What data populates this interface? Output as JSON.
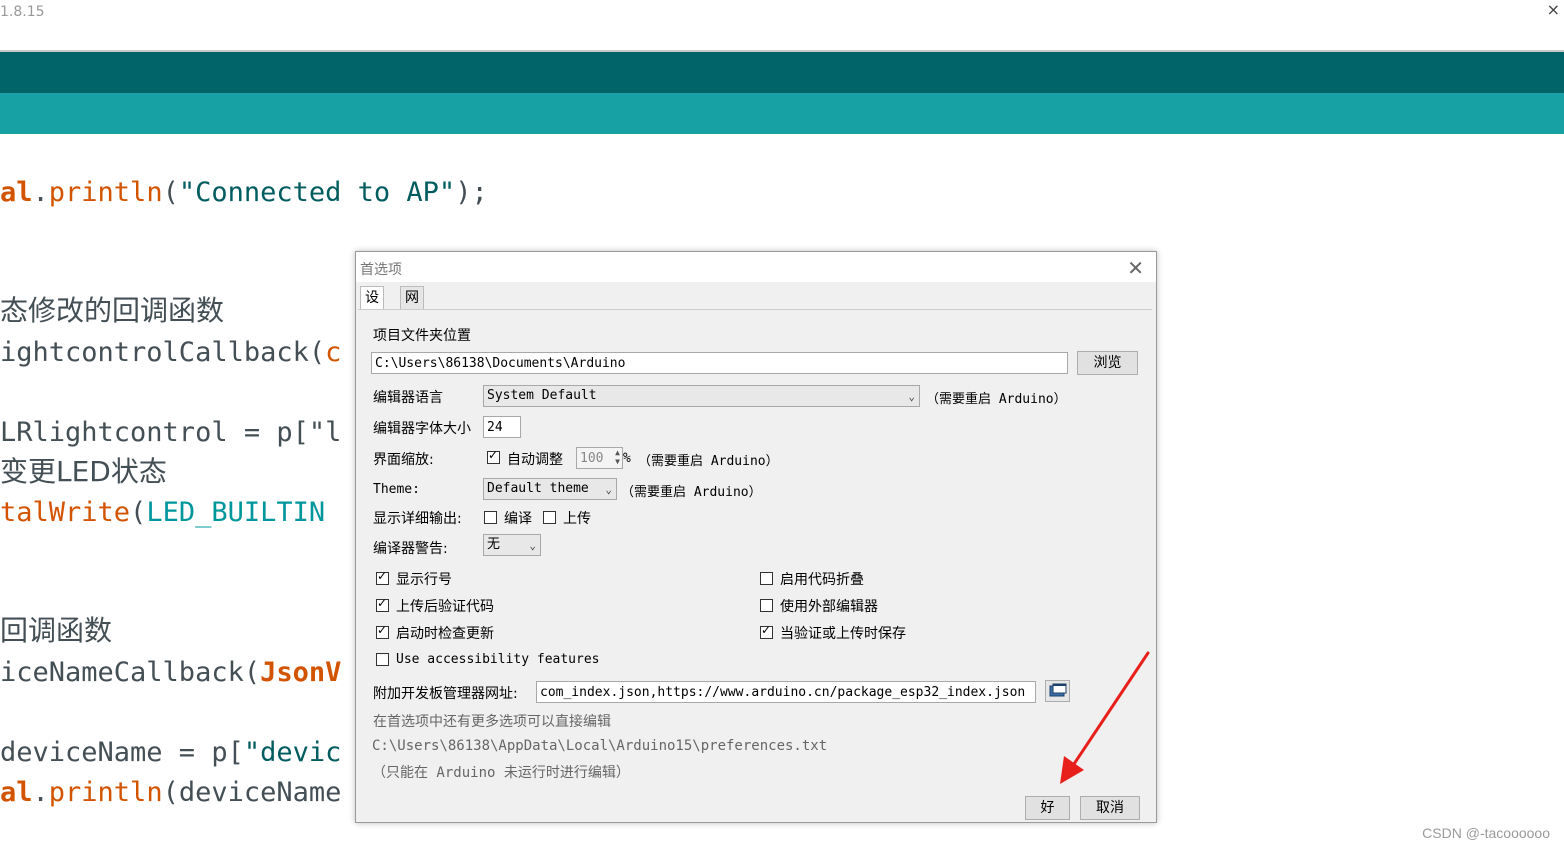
{
  "window": {
    "version": "1.8.15",
    "close": "×"
  },
  "code": {
    "line1": {
      "a": "al",
      "b": ".",
      "c": "println",
      "d": "(",
      "e": "\"Connected to AP\"",
      "f": ");"
    },
    "comment1": "态修改的回调函数",
    "line2": "ightcontrolCallback(",
    "line2_cut": "c",
    "line3": "LRlightcontrol = p[\"l",
    "comment2": "变更LED状态",
    "line4a": "talWrite",
    "line4b": "(",
    "line4c": "LED_BUILTIN",
    "comment3": "回调函数",
    "line5a": "iceNameCallback(",
    "line5b": "JsonV",
    "line6a": "deviceName = p[",
    "line6b": "\"devic",
    "line7a": "al",
    "line7b": ".",
    "line7c": "println",
    "line7d": "(deviceName"
  },
  "dialog": {
    "title": "首选项",
    "close_glyph": "✕",
    "tabs": [
      "设置",
      "网络"
    ],
    "sketchbook_label": "项目文件夹位置",
    "sketchbook_path": "C:\\Users\\86138\\Documents\\Arduino",
    "browse": "浏览",
    "language_label": "编辑器语言",
    "language_value": "System Default",
    "restart_note": "（需要重启 Arduino）",
    "fontsize_label": "编辑器字体大小",
    "fontsize_value": "24",
    "scale_label": "界面缩放:",
    "auto_scale": "自动调整",
    "scale_value": "100",
    "scale_pct": "%",
    "restart_note2": "（需要重启 Arduino）",
    "theme_label": "Theme:",
    "theme_value": "Default theme",
    "restart_note3": "（需要重启 Arduino）",
    "verbose_label": "显示详细输出:",
    "verbose_compile": "编译",
    "verbose_upload": "上传",
    "warnings_label": "编译器警告:",
    "warnings_value": "无",
    "opt_line_numbers": "显示行号",
    "opt_code_folding": "启用代码折叠",
    "opt_verify_upload": "上传后验证代码",
    "opt_external_editor": "使用外部编辑器",
    "opt_check_updates": "启动时检查更新",
    "opt_save_verify": "当验证或上传时保存",
    "opt_accessibility": "Use accessibility features",
    "boards_url_label": "附加开发板管理器网址:",
    "boards_url_value": "com_index.json,https://www.arduino.cn/package_esp32_index.json",
    "more_prefs": "在首选项中还有更多选项可以直接编辑",
    "prefs_path": "C:\\Users\\86138\\AppData\\Local\\Arduino15\\preferences.txt",
    "edit_note": "（只能在 Arduino 未运行时进行编辑）",
    "ok": "好",
    "cancel": "取消"
  },
  "checkbox_states": {
    "auto_scale": true,
    "verbose_compile": false,
    "verbose_upload": false,
    "line_numbers": true,
    "code_folding": false,
    "verify_upload": true,
    "external_editor": false,
    "check_updates": true,
    "save_verify": true,
    "accessibility": false
  },
  "watermark": "CSDN @-tacoooooo",
  "colors": {
    "toolbar_dark": "#006468",
    "toolbar_light": "#17a1a5",
    "arrow": "#e8201c"
  }
}
